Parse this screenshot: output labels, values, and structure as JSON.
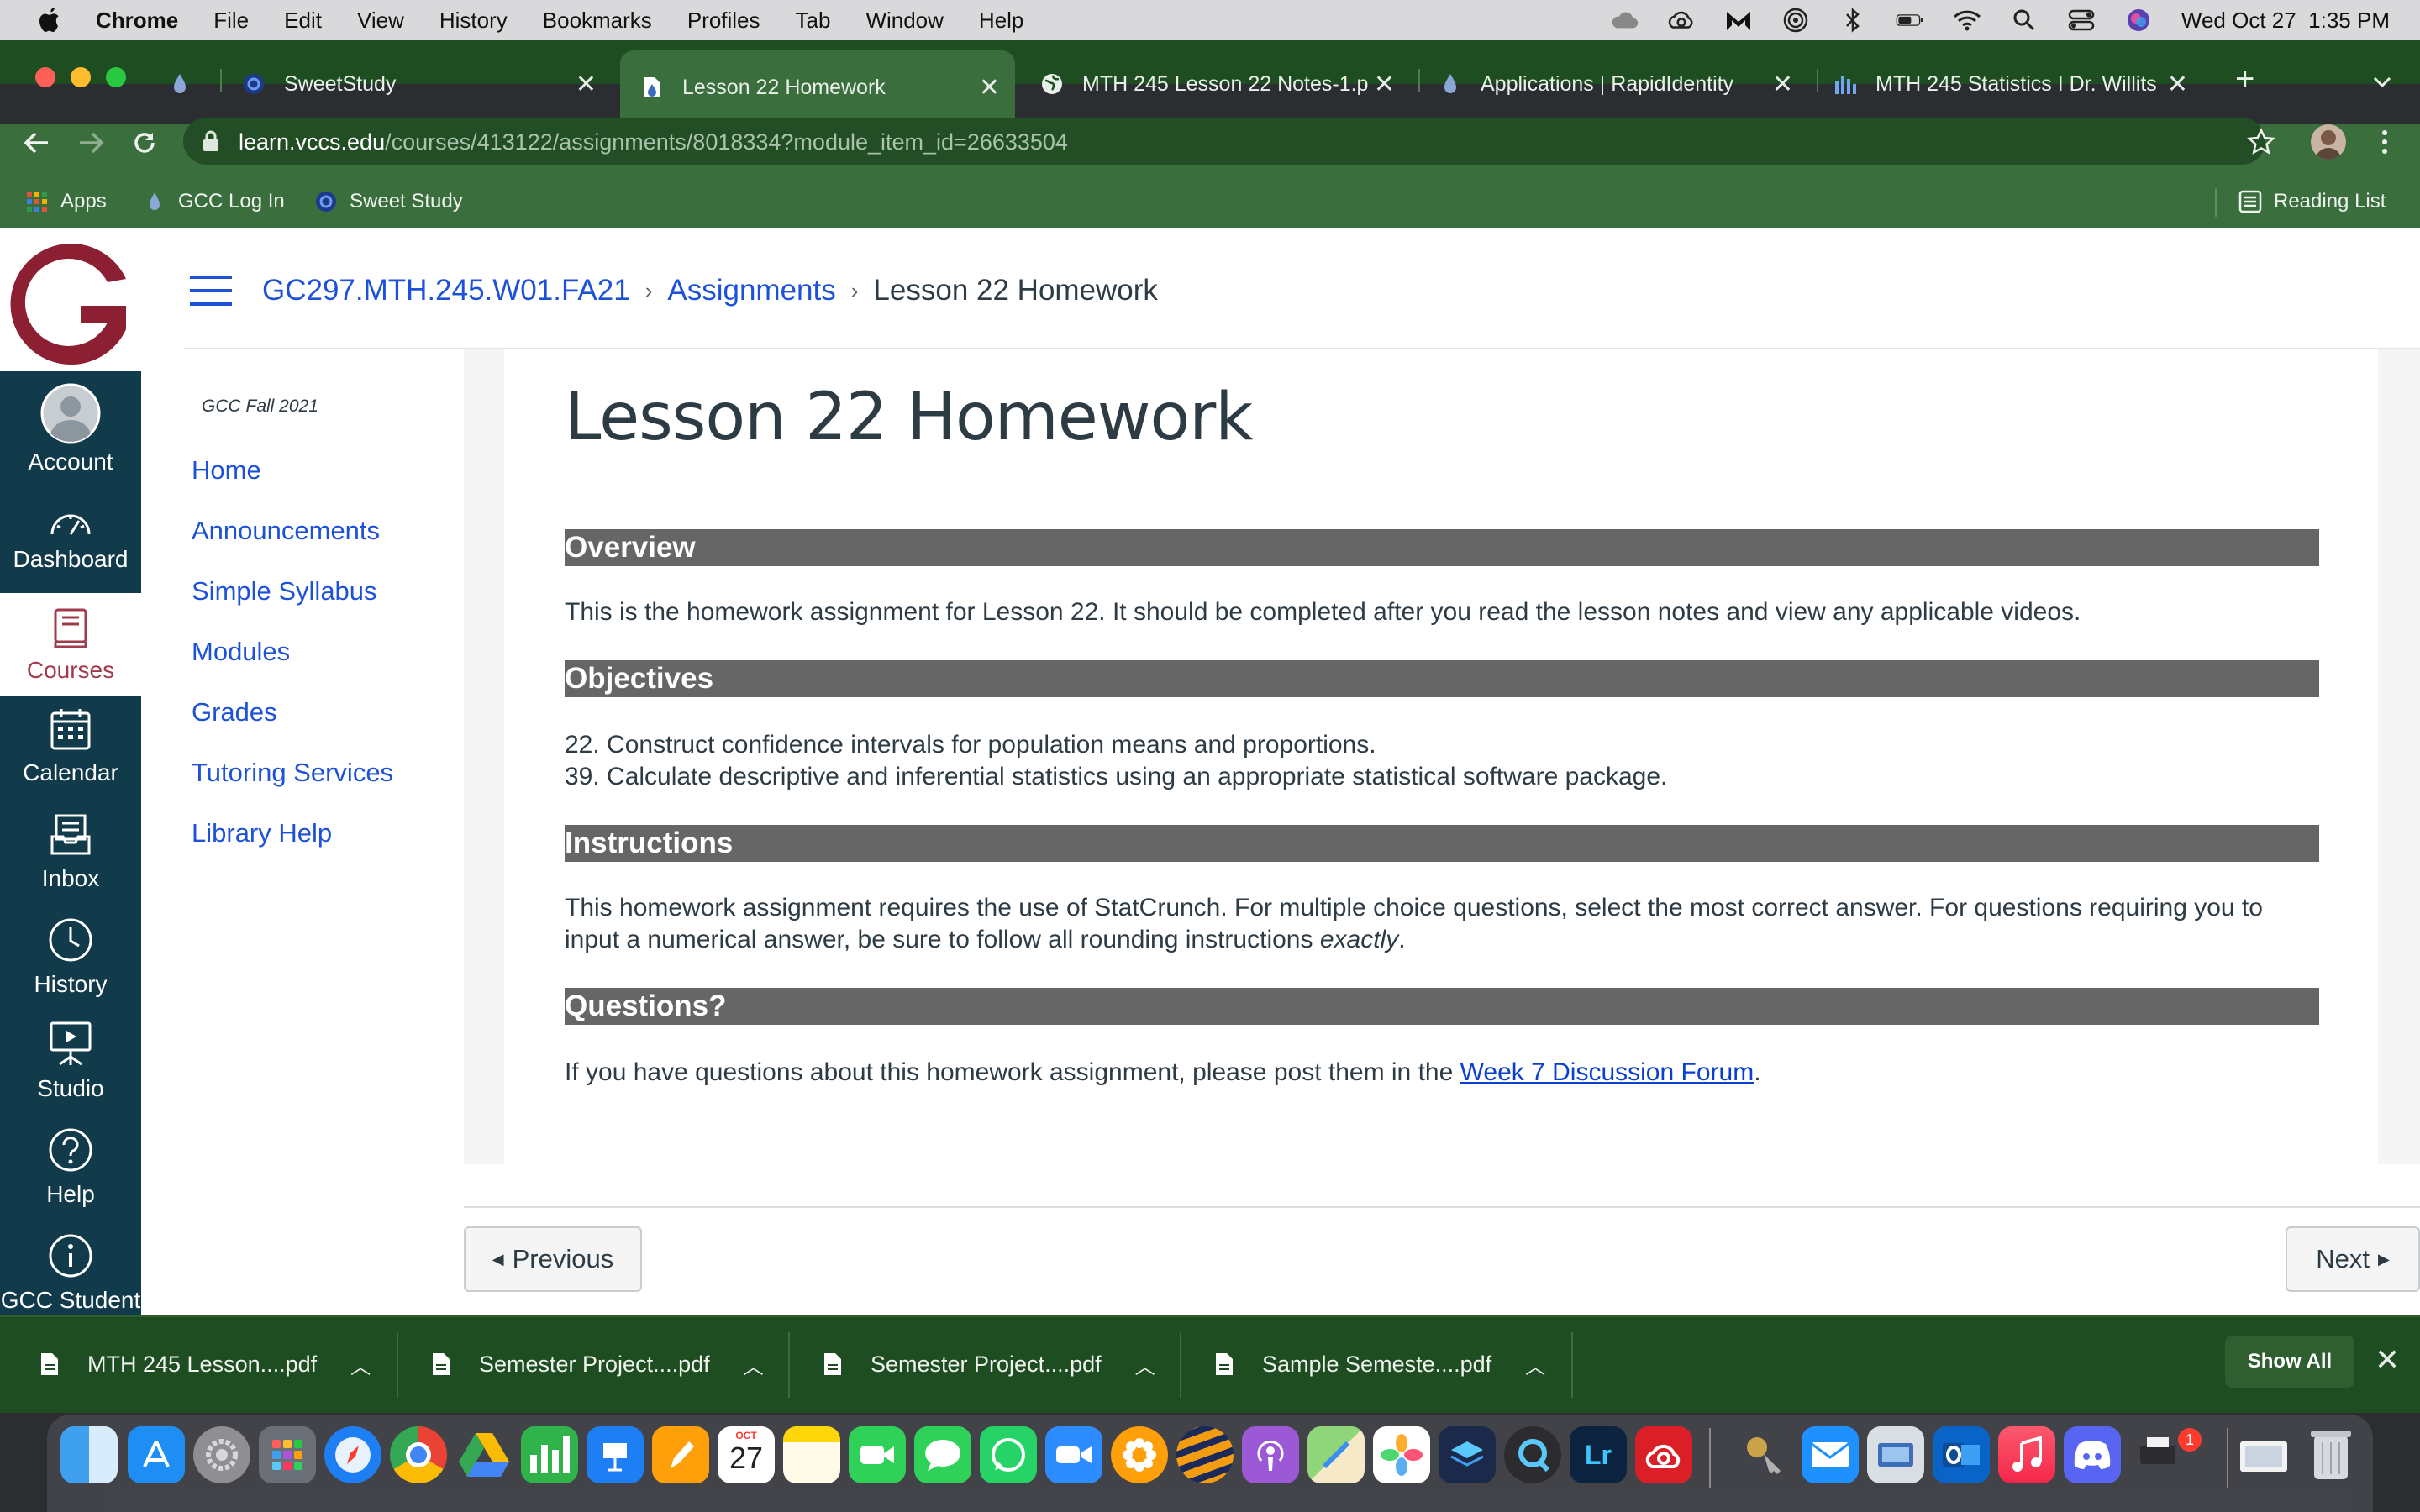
{
  "menubar": {
    "app": "Chrome",
    "items": [
      "File",
      "Edit",
      "View",
      "History",
      "Bookmarks",
      "Profiles",
      "Tab",
      "Window",
      "Help"
    ],
    "clock": "Wed Oct 27  1:35 PM"
  },
  "tabs": [
    {
      "label": "SweetStudy"
    },
    {
      "label": "Lesson 22 Homework"
    },
    {
      "label": "MTH 245 Lesson 22 Notes-1.p"
    },
    {
      "label": "Applications | RapidIdentity"
    },
    {
      "label": "MTH 245 Statistics I Dr. Willits"
    }
  ],
  "address": {
    "host": "learn.vccs.edu",
    "path": "/courses/413122/assignments/8018334?module_item_id=26633504"
  },
  "bookmarks": {
    "apps": "Apps",
    "gcc": "GCC Log In",
    "sweet": "Sweet Study",
    "reading_list": "Reading List"
  },
  "global_nav": {
    "account": "Account",
    "dashboard": "Dashboard",
    "courses": "Courses",
    "calendar": "Calendar",
    "inbox": "Inbox",
    "history": "History",
    "studio": "Studio",
    "help": "Help",
    "gcc_student": "GCC Student"
  },
  "breadcrumb": {
    "course": "GC297.MTH.245.W01.FA21",
    "assignments": "Assignments",
    "current": "Lesson 22 Homework"
  },
  "course_nav": {
    "term": "GCC Fall 2021",
    "links": [
      "Home",
      "Announcements",
      "Simple Syllabus",
      "Modules",
      "Grades",
      "Tutoring Services",
      "Library Help"
    ]
  },
  "assignment": {
    "title": "Lesson 22 Homework",
    "overview_head": "Overview",
    "overview_text": "This is the homework assignment for Lesson 22. It should be completed after you read the lesson notes and view any applicable videos.",
    "objectives_head": "Objectives",
    "objective_1": "22. Construct confidence intervals for population means and proportions.",
    "objective_2": "39. Calculate descriptive and inferential statistics using an appropriate statistical software package.",
    "instructions_head": "Instructions",
    "instructions_text": "This homework assignment requires the use of StatCrunch. For multiple choice questions, select the most correct answer. For questions requiring you to input a numerical answer, be sure to follow all rounding instructions ",
    "instructions_em": "exactly",
    "instructions_end": ".",
    "questions_head": "Questions?",
    "questions_text": "If you have questions about this homework assignment, please post them in the ",
    "questions_link": "Week 7 Discussion Forum",
    "questions_end": "."
  },
  "pager": {
    "previous": "Previous",
    "next": "Next"
  },
  "downloads": {
    "items": [
      "MTH 245 Lesson....pdf",
      "Semester Project....pdf",
      "Semester Project....pdf",
      "Sample Semeste....pdf"
    ],
    "show_all": "Show All"
  },
  "dock": {
    "calendar_month": "OCT",
    "calendar_day": "27",
    "lightroom": "Lr",
    "badge": "1"
  },
  "colors": {
    "chrome_frame": "#1f4d22",
    "chrome_toolbar": "#3b6e3d",
    "canvas_nav": "#113a4a",
    "link": "#1d52d8",
    "section_header": "#666666",
    "brand_red": "#8c2032"
  }
}
